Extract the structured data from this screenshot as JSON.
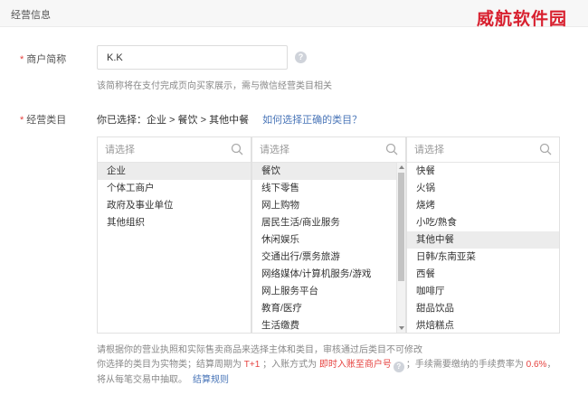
{
  "section": {
    "title": "经营信息"
  },
  "watermark": "威航软件园",
  "merchant_short_name": {
    "label": "商户简称",
    "value": "K.K",
    "hint": "该简称将在支付完成页向买家展示，需与微信经营类目相关"
  },
  "category": {
    "label": "经营类目",
    "selected_prefix": "你已选择：",
    "selected_path": "企业 > 餐饮 > 其他中餐",
    "help_link": "如何选择正确的类目？",
    "search_placeholder": "请选择",
    "columns": [
      {
        "items": [
          "企业",
          "个体工商户",
          "政府及事业单位",
          "其他组织"
        ],
        "selected_index": 0
      },
      {
        "items": [
          "餐饮",
          "线下零售",
          "网上购物",
          "居民生活/商业服务",
          "休闲娱乐",
          "交通出行/票务旅游",
          "网络媒体/计算机服务/游戏",
          "网上服务平台",
          "教育/医疗",
          "生活缴费"
        ],
        "selected_index": 0
      },
      {
        "items": [
          "快餐",
          "火锅",
          "烧烤",
          "小吃/熟食",
          "其他中餐",
          "日韩/东南亚菜",
          "西餐",
          "咖啡厅",
          "甜品饮品",
          "烘焙糕点"
        ],
        "selected_index": 4
      }
    ]
  },
  "notes": {
    "line1": "请根据你的营业执照和实际售卖商品来选择主体和类目，审核通过后类目不可修改",
    "line2_a": "你选择的类目为实物类；结算周期为 ",
    "settle_cycle": "T+1",
    "line2_b": " ；入账方式为 ",
    "settle_method": "即时入账至商户号",
    "line2_c": "；手续需要缴纳的手续费率为 ",
    "fee_rate": "0.6%",
    "line2_d": "，",
    "line3": "将从每笔交易中抽取。",
    "rules_link": "结算规则"
  }
}
